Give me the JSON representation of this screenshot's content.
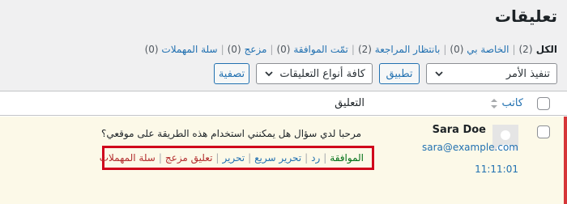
{
  "page": {
    "title": "تعليقات"
  },
  "filters": {
    "all": {
      "label": "الكل",
      "count": "(2)"
    },
    "mine": {
      "label": "الخاصة بي",
      "count": "(0)"
    },
    "pending": {
      "label": "بانتظار المراجعة",
      "count": "(2)"
    },
    "approved": {
      "label": "تمّت الموافقة",
      "count": "(0)"
    },
    "spam": {
      "label": "مزعج",
      "count": "(0)"
    },
    "trash": {
      "label": "سلة المهملات",
      "count": "(0)"
    },
    "separator": "|"
  },
  "toolbar": {
    "bulk_action": "تنفيذ الأمر",
    "apply": "تطبيق",
    "comment_type": "كافة أنواع التعليقات",
    "filter": "تصفية"
  },
  "table": {
    "col_author": "كاتب",
    "col_comment": "التعليق"
  },
  "comment": {
    "author": "Sara Doe",
    "email": "sara@example.com",
    "time": "11:11:01",
    "text": "مرحبا لدي سؤال هل يمكنني استخدام هذه الطريقة على موقعي؟",
    "actions": {
      "approve": "الموافقة",
      "reply": "رد",
      "quick_edit": "تحرير سريع",
      "edit": "تحرير",
      "spam": "تعليق مزعج",
      "trash": "سلة المهملات",
      "separator": "|"
    }
  },
  "colors": {
    "link": "#2271b1",
    "approve": "#007017",
    "danger": "#b32d2e",
    "highlight_border": "#d0021b",
    "unapproved_bg": "#fcf9e8"
  }
}
